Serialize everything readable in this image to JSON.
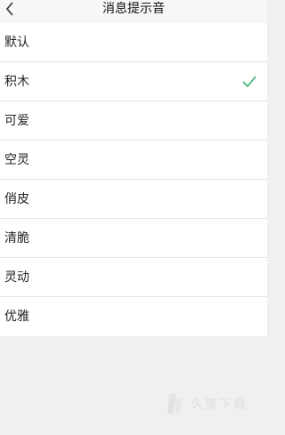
{
  "header": {
    "title": "消息提示音",
    "back_icon": "chevron-left-icon"
  },
  "sounds": [
    {
      "label": "默认",
      "selected": false
    },
    {
      "label": "积木",
      "selected": true
    },
    {
      "label": "可爱",
      "selected": false
    },
    {
      "label": "空灵",
      "selected": false
    },
    {
      "label": "俏皮",
      "selected": false
    },
    {
      "label": "清脆",
      "selected": false
    },
    {
      "label": "灵动",
      "selected": false
    },
    {
      "label": "优雅",
      "selected": false
    }
  ],
  "watermark": {
    "text": "久族下载"
  },
  "colors": {
    "check": "#3bb273",
    "background": "#f0f0f0",
    "list": "#ffffff"
  }
}
